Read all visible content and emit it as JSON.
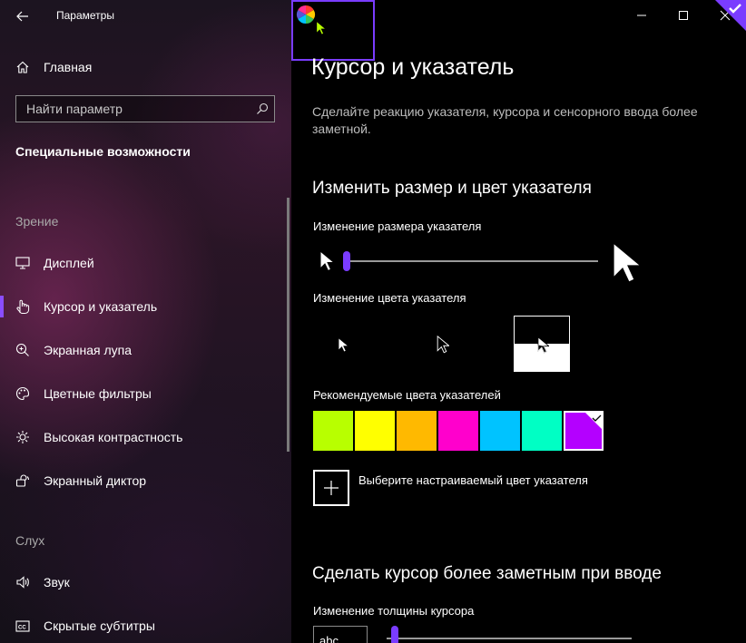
{
  "window": {
    "title": "Параметры"
  },
  "sidebar": {
    "home_label": "Главная",
    "search_placeholder": "Найти параметр",
    "section_title": "Специальные возможности",
    "groups": [
      {
        "heading": "Зрение",
        "items": [
          {
            "label": "Дисплей",
            "icon": "display-icon"
          },
          {
            "label": "Курсор и указатель",
            "icon": "pointer-hand-icon",
            "selected": true
          },
          {
            "label": "Экранная лупа",
            "icon": "magnifier-icon"
          },
          {
            "label": "Цветные фильтры",
            "icon": "palette-icon"
          },
          {
            "label": "Высокая контрастность",
            "icon": "contrast-sun-icon"
          },
          {
            "label": "Экранный диктор",
            "icon": "narrator-icon"
          }
        ]
      },
      {
        "heading": "Слух",
        "items": [
          {
            "label": "Звук",
            "icon": "speaker-icon"
          },
          {
            "label": "Скрытые субтитры",
            "icon": "captions-icon"
          }
        ]
      }
    ]
  },
  "main": {
    "title": "Курсор и указатель",
    "description": "Сделайте реакцию указателя, курсора и сенсорного ввода более заметной.",
    "pointer_section": {
      "heading": "Изменить размер и цвет указателя",
      "size_label": "Изменение размера указателя",
      "size_value": 1,
      "color_label": "Изменение цвета указателя",
      "color_options": [
        "white",
        "black",
        "inverted",
        "custom"
      ],
      "selected_color_option": "custom",
      "recommended_label": "Рекомендуемые цвета указателей",
      "recommended_colors": [
        "#b8ff00",
        "#ffff00",
        "#ffb900",
        "#ff00cc",
        "#00c3ff",
        "#00ffc4",
        "#b400ff"
      ],
      "selected_recommended": "#b400ff",
      "custom_color_label": "Выберите настраиваемый цвет указателя"
    },
    "cursor_section": {
      "heading": "Сделать курсор более заметным при вводе",
      "thickness_label": "Изменение толщины курсора",
      "thickness_preview_text": "abc",
      "thickness_value": 1
    }
  },
  "colors": {
    "accent": "#7a3cff"
  }
}
